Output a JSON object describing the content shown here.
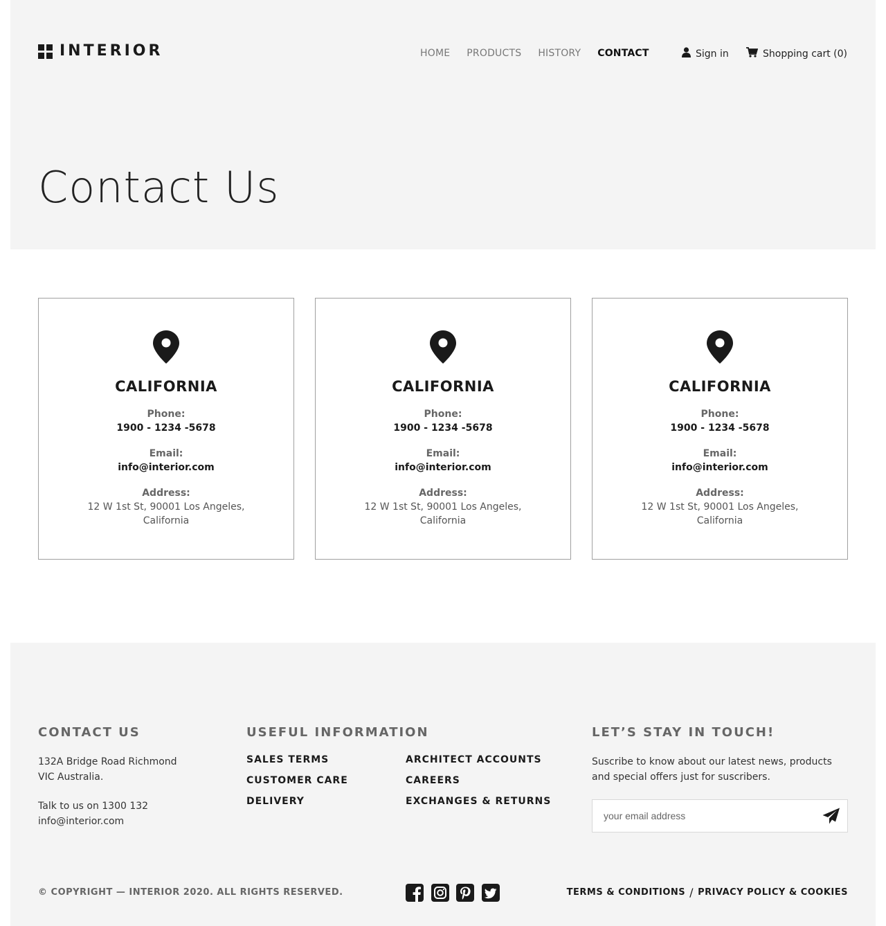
{
  "header": {
    "logo_text": "INTERIOR",
    "nav": [
      "HOME",
      "PRODUCTS",
      "HISTORY",
      "CONTACT"
    ],
    "active_nav": "CONTACT",
    "sign_in": "Sign in",
    "cart": "Shopping cart (0)"
  },
  "hero": {
    "title": "Contact Us"
  },
  "locations": [
    {
      "city": "CALIFORNIA",
      "phone_label": "Phone:",
      "phone": "1900 - 1234 -5678",
      "email_label": "Email:",
      "email": "info@interior.com",
      "address_label": "Address:",
      "address": "12 W 1st St, 90001 Los Angeles, California"
    },
    {
      "city": "CALIFORNIA",
      "phone_label": "Phone:",
      "phone": "1900 - 1234 -5678",
      "email_label": "Email:",
      "email": "info@interior.com",
      "address_label": "Address:",
      "address": "12 W 1st St, 90001 Los Angeles, California"
    },
    {
      "city": "CALIFORNIA",
      "phone_label": "Phone:",
      "phone": "1900 - 1234 -5678",
      "email_label": "Email:",
      "email": "info@interior.com",
      "address_label": "Address:",
      "address": "12 W 1st St, 90001 Los Angeles, California"
    }
  ],
  "footer": {
    "contact": {
      "heading": "CONTACT US",
      "address_line1": "132A Bridge Road Richmond",
      "address_line2": "VIC Australia.",
      "phone_line": "Talk to us on 1300 132",
      "email": "info@interior.com"
    },
    "useful": {
      "heading": "USEFUL INFORMATION",
      "col1": [
        "SALES TERMS",
        "CUSTOMER CARE",
        "DELIVERY"
      ],
      "col2": [
        "ARCHITECT ACCOUNTS",
        "CAREERS",
        "EXCHANGES & RETURNS"
      ]
    },
    "newsletter": {
      "heading": "LET’S STAY IN TOUCH!",
      "text_line1": "Suscribe to know about our latest news, products",
      "text_line2": "and special offers just for suscribers.",
      "placeholder": "your email address"
    },
    "copyright": "© COPYRIGHT — INTERIOR 2020. ALL RIGHTS RESERVED.",
    "social_icons": [
      "facebook-icon",
      "instagram-icon",
      "pinterest-icon",
      "twitter-icon"
    ],
    "terms": "TERMS & CONDITIONS",
    "separator": "/",
    "privacy": "PRIVACY POLICY & COOKIES"
  },
  "colors": {
    "background_grey": "#f4f4f4",
    "text_dark": "#1a1a1a",
    "text_grey": "#666666",
    "card_border": "#a0a0a0"
  }
}
